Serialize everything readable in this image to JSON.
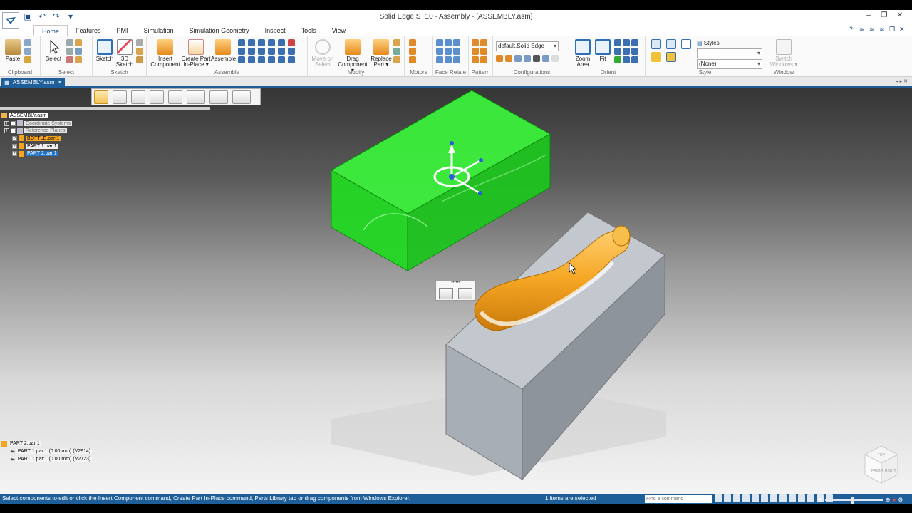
{
  "window": {
    "title": "Solid Edge ST10 - Assembly - [ASSEMBLY.asm]",
    "controls": [
      "–",
      "❐",
      "✕"
    ]
  },
  "tabs": [
    {
      "label": "Home",
      "active": true
    },
    {
      "label": "Features"
    },
    {
      "label": "PMI"
    },
    {
      "label": "Simulation"
    },
    {
      "label": "Simulation Geometry"
    },
    {
      "label": "Inspect"
    },
    {
      "label": "Tools"
    },
    {
      "label": "View"
    }
  ],
  "ribbon": {
    "groups": {
      "clipboard": "Clipboard",
      "select": "Select",
      "sketch": "Sketch",
      "assemble": "Assemble",
      "modify": "Modify",
      "motors": "Motors",
      "face_relate": "Face Relate",
      "pattern": "Pattern",
      "configurations": "Configurations",
      "orient": "Orient",
      "style": "Style",
      "window": "Window"
    },
    "buttons": {
      "paste": "Paste",
      "select": "Select",
      "sketch": "Sketch",
      "sketch3d_1": "3D",
      "sketch3d_2": "Sketch",
      "insert_1": "Insert",
      "insert_2": "Component",
      "create_1": "Create Part",
      "create_2": "In-Place ▾",
      "assemble": "Assemble",
      "move_1": "Move on",
      "move_2": "Select",
      "drag_1": "Drag",
      "drag_2": "Component ▾",
      "replace_1": "Replace",
      "replace_2": "Part ▾",
      "zoom_1": "Zoom",
      "zoom_2": "Area",
      "fit": "Fit",
      "switch_1": "Switch",
      "switch_2": "Windows ▾"
    },
    "config_value": "default,Solid Edge",
    "styles_label": "Styles",
    "style_value": "",
    "style_none": "(None)"
  },
  "document_tab": {
    "label": "ASSEMBLY.asm",
    "close": "✕"
  },
  "tree": {
    "root": "ASSEMBLY.asm",
    "items": [
      {
        "label": "Coordinate Systems",
        "style": "grey"
      },
      {
        "label": "Reference Planes",
        "style": "grey"
      },
      {
        "label": "BOTTLE.par:1",
        "style": "orange"
      },
      {
        "label": "PART 1.par:1",
        "style": "white"
      },
      {
        "label": "PART 2.par:1",
        "style": "blue"
      }
    ]
  },
  "relationships": {
    "header": "PART 2.par:1",
    "rows": [
      {
        "part": "PART 1.par:1",
        "offset": "(0.00 mm)",
        "id": "(V2914)"
      },
      {
        "part": "PART 1.par:1",
        "offset": "(0.00 mm)",
        "id": "(V2723)"
      }
    ]
  },
  "viewcube": {
    "front": "FRONT",
    "right": "RIGHT",
    "top": "TOP"
  },
  "status": {
    "message": "Select components to edit or click the Insert Component command, Create Part In-Place command, Parts Library tab or drag components from Windows Explorer.",
    "selection": "1 items are selected",
    "find_placeholder": "Find a command"
  },
  "colors": {
    "accent": "#1f5f99",
    "green_part": "#22e022",
    "bottle": "#f5a623",
    "block": "#b8bec6"
  }
}
